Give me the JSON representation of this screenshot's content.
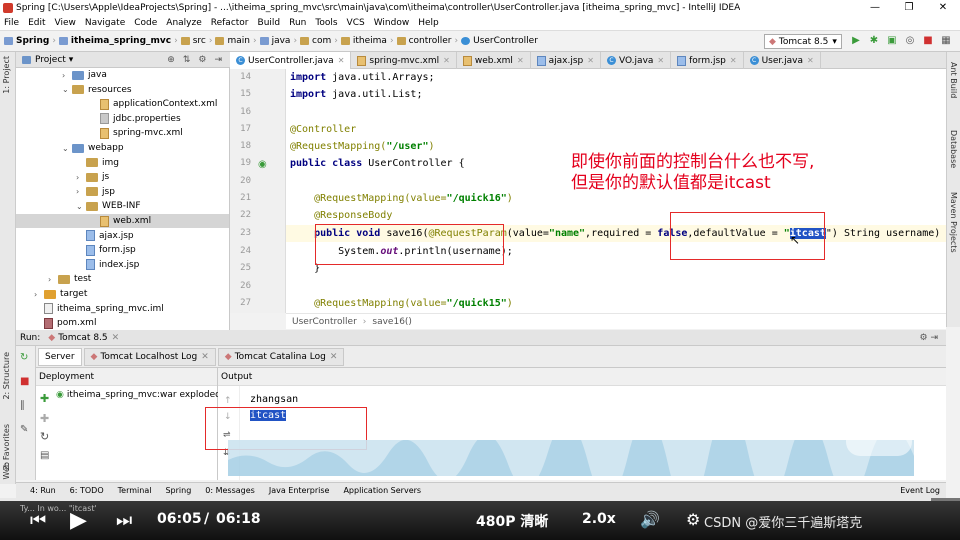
{
  "window": {
    "title": "Spring [C:\\Users\\Apple\\IdeaProjects\\Spring] - ...\\itheima_spring_mvc\\src\\main\\java\\com\\itheima\\controller\\UserController.java [itheima_spring_mvc] - IntelliJ IDEA",
    "min": "—",
    "max": "❐",
    "close": "✕"
  },
  "menu": [
    "File",
    "Edit",
    "View",
    "Navigate",
    "Code",
    "Analyze",
    "Refactor",
    "Build",
    "Run",
    "Tools",
    "VCS",
    "Window",
    "Help"
  ],
  "breadcrumb": [
    "Spring",
    "itheima_spring_mvc",
    "src",
    "main",
    "java",
    "com",
    "itheima",
    "controller",
    "UserController"
  ],
  "run_config": "Tomcat 8.5",
  "left_tabs": [
    "1: Project",
    "2: Structure",
    "2: Favorites",
    "Web"
  ],
  "right_tabs": [
    "Ant Build",
    "Database",
    "Maven Projects"
  ],
  "project_panel": {
    "title": "Project",
    "tree": [
      {
        "label": "java",
        "icon": "folder-blue",
        "level": 3,
        "arrow": "›"
      },
      {
        "label": "resources",
        "icon": "folder",
        "level": 3,
        "arrow": "⌄"
      },
      {
        "label": "applicationContext.xml",
        "icon": "xml",
        "level": 5,
        "arrow": ""
      },
      {
        "label": "jdbc.properties",
        "icon": "prop",
        "level": 5,
        "arrow": ""
      },
      {
        "label": "spring-mvc.xml",
        "icon": "xml",
        "level": 5,
        "arrow": ""
      },
      {
        "label": "webapp",
        "icon": "folder-blue",
        "level": 3,
        "arrow": "⌄"
      },
      {
        "label": "img",
        "icon": "folder",
        "level": 4,
        "arrow": ""
      },
      {
        "label": "js",
        "icon": "folder",
        "level": 4,
        "arrow": "›"
      },
      {
        "label": "jsp",
        "icon": "folder",
        "level": 4,
        "arrow": "›"
      },
      {
        "label": "WEB-INF",
        "icon": "folder",
        "level": 4,
        "arrow": "⌄"
      },
      {
        "label": "web.xml",
        "icon": "xml",
        "level": 5,
        "arrow": ""
      },
      {
        "label": "ajax.jsp",
        "icon": "jsp",
        "level": 4,
        "arrow": ""
      },
      {
        "label": "form.jsp",
        "icon": "jsp",
        "level": 4,
        "arrow": ""
      },
      {
        "label": "index.jsp",
        "icon": "jsp",
        "level": 4,
        "arrow": ""
      },
      {
        "label": "test",
        "icon": "folder",
        "level": 2,
        "arrow": "›"
      },
      {
        "label": "target",
        "icon": "folder-orange",
        "level": 1,
        "arrow": "›"
      },
      {
        "label": "itheima_spring_mvc.iml",
        "icon": "iml",
        "level": 1,
        "arrow": ""
      },
      {
        "label": "pom.xml",
        "icon": "pom",
        "level": 1,
        "arrow": ""
      }
    ]
  },
  "editor_tabs": [
    {
      "label": "UserController.java",
      "type": "class",
      "active": true
    },
    {
      "label": "spring-mvc.xml",
      "type": "xml",
      "active": false
    },
    {
      "label": "web.xml",
      "type": "xml",
      "active": false
    },
    {
      "label": "ajax.jsp",
      "type": "jsp",
      "active": false
    },
    {
      "label": "VO.java",
      "type": "class",
      "active": false
    },
    {
      "label": "form.jsp",
      "type": "jsp",
      "active": false
    },
    {
      "label": "User.java",
      "type": "class",
      "active": false
    }
  ],
  "line_numbers": [
    "14",
    "15",
    "16",
    "17",
    "18",
    "19",
    "20",
    "21",
    "22",
    "23",
    "24",
    "25",
    "26",
    "27"
  ],
  "code": {
    "l14a": "import ",
    "l14b": "java.util.Arrays;",
    "l15a": "import ",
    "l15b": "java.util.List;",
    "l17": "@Controller",
    "l18a": "@RequestMapping(",
    "l18b": "\"/user\"",
    "l18c": ")",
    "l19a": "public class ",
    "l19b": "UserController {",
    "l21a": "    @RequestMapping(value=",
    "l21b": "\"/quick16\"",
    "l21c": ")",
    "l22": "    @ResponseBody",
    "l23a": "    public void ",
    "l23b": "save16(",
    "l23c": "@RequestParam",
    "l23d": "(value=",
    "l23e": "\"name\"",
    "l23f": ",required = ",
    "l23g": "false",
    "l23h": ",defaultValue = ",
    "l23i": "\"",
    "l23j": "itcast",
    "l23k": "\") String username) ",
    "l23l": "thro",
    "l24a": "        System.",
    "l24b": "out",
    "l24c": ".println(username);",
    "l25": "    }",
    "l27a": "    @RequestMapping(value=",
    "l27b": "\"/quick15\"",
    "l27c": ")"
  },
  "editor_breadcrumb": [
    "UserController",
    "save16()"
  ],
  "overlay_text": [
    "即使你前面的控制台什么也不写,",
    "但是你的默认值都是itcast"
  ],
  "run_panel": {
    "label": "Run:",
    "config": "Tomcat 8.5",
    "tabs": [
      "Server",
      "Tomcat Localhost Log",
      "Tomcat Catalina Log"
    ],
    "deployment_header": "Deployment",
    "deployment_item": "itheima_spring_mvc:war exploded",
    "output_header": "Output",
    "output_lines": [
      "zhangsan",
      "itcast"
    ]
  },
  "bottom_tabs": [
    "4: Run",
    "6: TODO",
    "Terminal",
    "Spring",
    "0: Messages",
    "Java Enterprise",
    "Application Servers",
    "Event Log"
  ],
  "status_text": "Ty... In wo... \"itcast'",
  "video": {
    "time_current": "06:05",
    "time_sep": "/",
    "time_total": "06:18",
    "quality": "480P 清晰",
    "speed": "2.0x",
    "watermark": "CSDN @爱你三千遍斯塔克",
    "progress": 0.97
  }
}
